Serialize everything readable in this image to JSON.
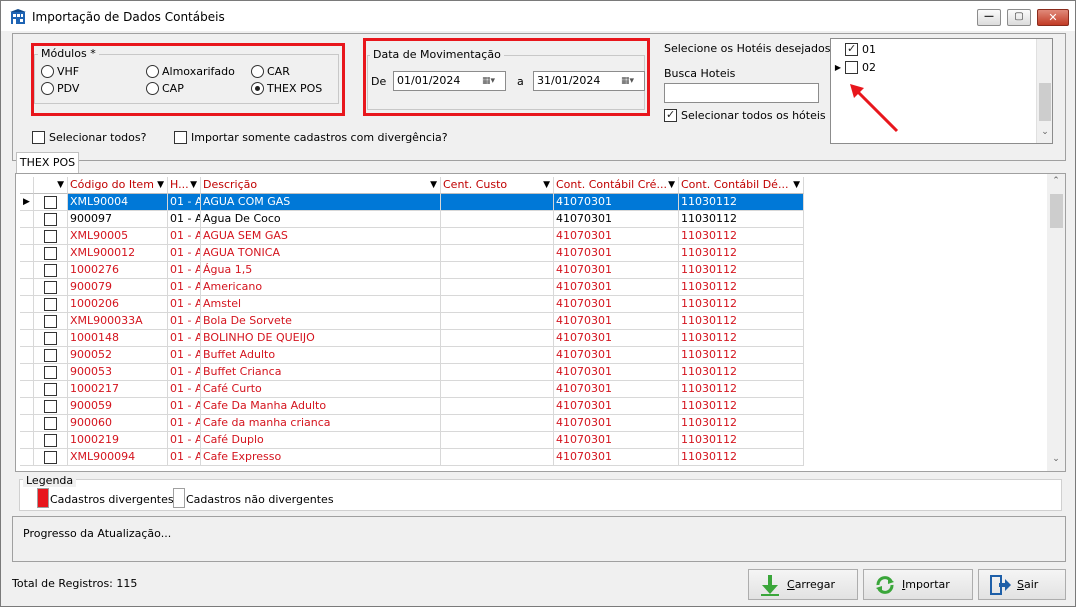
{
  "window": {
    "title": "Importação de Dados Contábeis",
    "controls": {
      "minimize": "—",
      "maximize": "▢",
      "close": "✕"
    }
  },
  "modulos": {
    "title": "Módulos *",
    "options": [
      {
        "label": "VHF",
        "selected": false
      },
      {
        "label": "Almoxarifado",
        "selected": false
      },
      {
        "label": "CAR",
        "selected": false
      },
      {
        "label": "PDV",
        "selected": false
      },
      {
        "label": "CAP",
        "selected": false
      },
      {
        "label": "THEX POS",
        "selected": true
      }
    ]
  },
  "periodo": {
    "title": "Data de Movimentação",
    "from_label": "De",
    "from_value": "01/01/2024",
    "to_label": "a",
    "to_value": "31/01/2024"
  },
  "hoteis": {
    "label": "Selecione os Hotéis desejados *",
    "search_label": "Busca Hoteis",
    "search_value": "",
    "select_all_label": "Selecionar todos os hóteis",
    "select_all_checked": true,
    "items": [
      {
        "code": "01",
        "checked": true,
        "current": false
      },
      {
        "code": "02",
        "checked": false,
        "current": true
      }
    ]
  },
  "options": {
    "select_all": "Selecionar todos?",
    "only_divergent": "Importar somente cadastros com divergência?"
  },
  "tab": {
    "label": "THEX POS"
  },
  "grid": {
    "columns": [
      "Código do Item",
      "H...",
      "Descrição",
      "Cent. Custo",
      "Cont. Contábil Cré...",
      "Cont. Contábil Dé..."
    ],
    "rows": [
      {
        "code": "XML90004",
        "h": "01 - A",
        "desc": "AGUA COM GAS",
        "cc": "",
        "cred": "41070301",
        "deb": "11030112",
        "divergent": false,
        "selected": true
      },
      {
        "code": "900097",
        "h": "01 - A",
        "desc": "Agua De Coco",
        "cc": "",
        "cred": "41070301",
        "deb": "11030112",
        "divergent": false,
        "selected": false
      },
      {
        "code": "XML90005",
        "h": "01 - A",
        "desc": "AGUA SEM GAS",
        "cc": "",
        "cred": "41070301",
        "deb": "11030112",
        "divergent": true,
        "selected": false
      },
      {
        "code": "XML900012",
        "h": "01 - A",
        "desc": "AGUA TONICA",
        "cc": "",
        "cred": "41070301",
        "deb": "11030112",
        "divergent": true,
        "selected": false
      },
      {
        "code": "1000276",
        "h": "01 - A",
        "desc": "Água 1,5",
        "cc": "",
        "cred": "41070301",
        "deb": "11030112",
        "divergent": true,
        "selected": false
      },
      {
        "code": "900079",
        "h": "01 - A",
        "desc": "Americano",
        "cc": "",
        "cred": "41070301",
        "deb": "11030112",
        "divergent": true,
        "selected": false
      },
      {
        "code": "1000206",
        "h": "01 - A",
        "desc": "Amstel",
        "cc": "",
        "cred": "41070301",
        "deb": "11030112",
        "divergent": true,
        "selected": false
      },
      {
        "code": "XML900033A",
        "h": "01 - A",
        "desc": "Bola De Sorvete",
        "cc": "",
        "cred": "41070301",
        "deb": "11030112",
        "divergent": true,
        "selected": false
      },
      {
        "code": "1000148",
        "h": "01 - A",
        "desc": "BOLINHO DE QUEIJO",
        "cc": "",
        "cred": "41070301",
        "deb": "11030112",
        "divergent": true,
        "selected": false
      },
      {
        "code": "900052",
        "h": "01 - A",
        "desc": "Buffet Adulto",
        "cc": "",
        "cred": "41070301",
        "deb": "11030112",
        "divergent": true,
        "selected": false
      },
      {
        "code": "900053",
        "h": "01 - A",
        "desc": "Buffet Crianca",
        "cc": "",
        "cred": "41070301",
        "deb": "11030112",
        "divergent": true,
        "selected": false
      },
      {
        "code": "1000217",
        "h": "01 - A",
        "desc": "Café Curto",
        "cc": "",
        "cred": "41070301",
        "deb": "11030112",
        "divergent": true,
        "selected": false
      },
      {
        "code": "900059",
        "h": "01 - A",
        "desc": "Cafe Da Manha Adulto",
        "cc": "",
        "cred": "41070301",
        "deb": "11030112",
        "divergent": true,
        "selected": false
      },
      {
        "code": "900060",
        "h": "01 - A",
        "desc": "Cafe da manha crianca",
        "cc": "",
        "cred": "41070301",
        "deb": "11030112",
        "divergent": true,
        "selected": false
      },
      {
        "code": "1000219",
        "h": "01 - A",
        "desc": "Café Duplo",
        "cc": "",
        "cred": "41070301",
        "deb": "11030112",
        "divergent": true,
        "selected": false
      },
      {
        "code": "XML900094",
        "h": "01 - A",
        "desc": "Cafe Expresso",
        "cc": "",
        "cred": "41070301",
        "deb": "11030112",
        "divergent": true,
        "selected": false
      }
    ]
  },
  "legenda": {
    "title": "Legenda",
    "divergent_label": "Cadastros divergentes",
    "divergent_color": "#e8161c",
    "non_divergent_label": "Cadastros não divergentes",
    "non_divergent_color": "#ffffff"
  },
  "progress": {
    "label": "Progresso da Atualização..."
  },
  "footer": {
    "total": "Total de Registros: 115",
    "buttons": [
      {
        "label": "Carregar",
        "accel": "C",
        "rest": "arregar",
        "icon": "down-arrow-icon"
      },
      {
        "label": "Importar",
        "accel": "I",
        "rest": "mportar",
        "icon": "refresh-icon"
      },
      {
        "label": "Sair",
        "accel": "S",
        "rest": "air",
        "icon": "exit-door-icon"
      }
    ]
  },
  "colors": {
    "selection": "#0078d7",
    "divergent_text": "#d4141e",
    "highlight_box": "#e8161c"
  }
}
